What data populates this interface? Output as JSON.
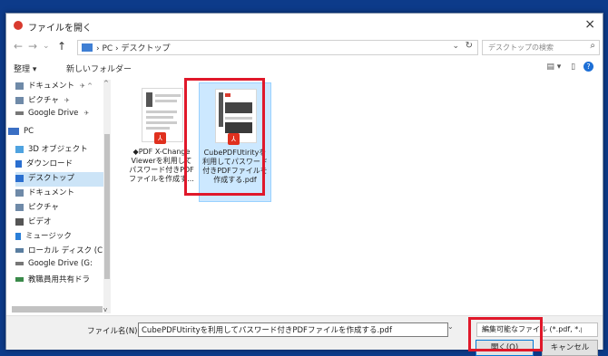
{
  "window": {
    "title": "ファイルを開く",
    "close_glyph": "×"
  },
  "nav": {
    "back": "←",
    "forward": "→",
    "dropdown": "⌄",
    "up": "↑",
    "breadcrumbs": "› PC › デスクトップ",
    "addr_dropdown": "⌄",
    "refresh": "↻",
    "search_placeholder": "デスクトップの検索",
    "search_icon": "⌕"
  },
  "toolbar": {
    "organize": "整理 ▾",
    "new_folder": "新しいフォルダー",
    "view_options": "▤ ▾",
    "preview_pane": "▯",
    "help": "?"
  },
  "sidebar": {
    "items": [
      {
        "label": "ドキュメント",
        "pin": "✈ ^",
        "icon": "document-icon",
        "color": "#6f8aa8"
      },
      {
        "label": "ピクチャ",
        "pin": "✈",
        "icon": "pictures-icon",
        "color": "#6f8aa8"
      },
      {
        "label": "Google Drive",
        "pin": "✈",
        "icon": "google-drive-icon",
        "color": "#777777"
      },
      {
        "label": "PC",
        "pin": "",
        "icon": "pc-icon",
        "color": "#3a6fc4"
      },
      {
        "label": "3D オブジェクト",
        "pin": "",
        "icon": "3d-objects-icon",
        "color": "#4fa3e0"
      },
      {
        "label": "ダウンロード",
        "pin": "",
        "icon": "download-icon",
        "color": "#2a6fd0"
      },
      {
        "label": "デスクトップ",
        "pin": "",
        "icon": "desktop-icon",
        "color": "#2a6fd0"
      },
      {
        "label": "ドキュメント",
        "pin": "",
        "icon": "document-icon",
        "color": "#6f8aa8"
      },
      {
        "label": "ピクチャ",
        "pin": "",
        "icon": "pictures-icon",
        "color": "#6f8aa8"
      },
      {
        "label": "ビデオ",
        "pin": "",
        "icon": "video-icon",
        "color": "#555555"
      },
      {
        "label": "ミュージック",
        "pin": "",
        "icon": "music-icon",
        "color": "#2a7fd8"
      },
      {
        "label": "ローカル ディスク (C",
        "pin": "",
        "icon": "disk-icon",
        "color": "#5a7ea0"
      },
      {
        "label": "Google Drive (G:",
        "pin": "",
        "icon": "drive-icon",
        "color": "#777777"
      },
      {
        "label": "教職員用共有ドラ",
        "pin": "",
        "icon": "network-drive-icon",
        "color": "#3a8a4a"
      }
    ]
  },
  "files": [
    {
      "name": "◆PDF X-Change Viewerを利用してパスワード付きPDFファイルを作成す...",
      "selected": false
    },
    {
      "name": "CubePDFUtirityを利用してパスワード付きPDFファイルを作成する.pdf",
      "selected": true
    }
  ],
  "pdf_badge": "⅄",
  "scroll": {
    "up": "^",
    "down": "v"
  },
  "footer": {
    "filename_label": "ファイル名(N):",
    "filename_value": "CubePDFUtirityを利用してパスワード付きPDFファイルを作成する.pdf",
    "filename_dropdown": "⌄",
    "filter": "編集可能なファイル (*.pdf, *.png,",
    "filter_dropdown": "⌄",
    "open": "開く(O)",
    "cancel": "キャンセル"
  }
}
